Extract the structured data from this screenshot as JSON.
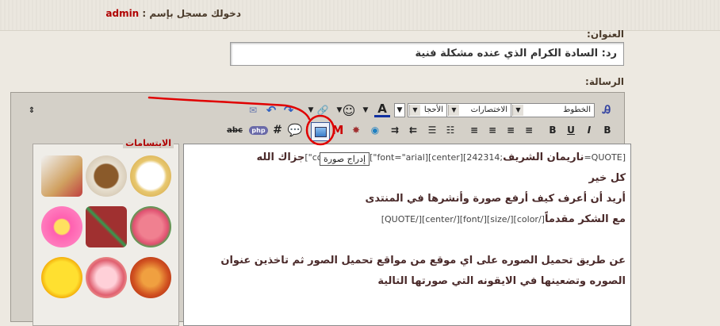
{
  "header": {
    "login_prefix": "دخولك مسجل بإسم :",
    "username": "admin"
  },
  "form": {
    "title_label": "العنوان:",
    "title_value": "رد: السادة الكرام الذي عنده مشكلة فنية",
    "message_label": "الرسالة:"
  },
  "toolbar": {
    "font_select": "الخطوط",
    "shortcuts_select": "الاختصارات",
    "size_select": "الأحجا",
    "insert_image_tooltip": "إدراج صورة",
    "code_label": "#",
    "strike_label": "abc",
    "php_label": "php"
  },
  "smilies": {
    "title": "الابتسامات",
    "icons": [
      "book-icon",
      "coffee-icon",
      "lucky-cat-icon",
      "flower-icon",
      "gift-icon",
      "rose-icon",
      "sun-icon",
      "cake-icon",
      "butterfly-icon"
    ]
  },
  "message": {
    "line1_code": "[QUOTE=",
    "line1_name": "ناريمان الشريف",
    "line1_tail": ";242314][center][font=\"arial\"][color=\"navy\"]",
    "line1_end": "جزاك الله",
    "line2": "كل خير",
    "line3": "أريد أن أعرف كيف أرفع صورة وأنشرها في المنتدى",
    "line4_bold": "مع الشكر مقدماً",
    "line4_code": "[/color][/size][/font][/center][/QUOTE]",
    "line5": "عن طريق تحميل الصوره على اي موقع من مواقع تحميل الصور ثم تاخذين عنوان",
    "line6": "الصوره وتضعينها في الايقونه التي صورتها التالية"
  },
  "colors": {
    "accent_red": "#e00000",
    "username": "#b00000",
    "toolbar_bg": "#d4d0c8"
  }
}
